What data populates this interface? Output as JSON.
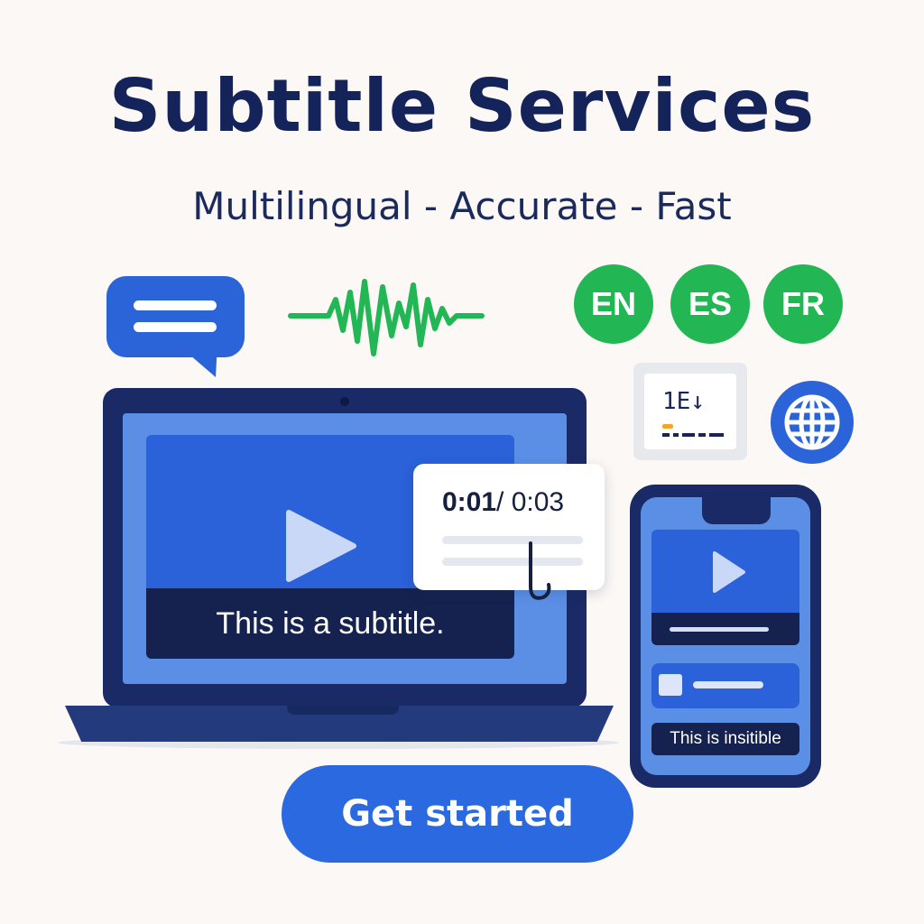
{
  "header": {
    "title": "Subtitle Services",
    "tagline": "Multilingual - Accurate - Fast"
  },
  "languages": [
    "EN",
    "ES",
    "FR"
  ],
  "editor_icon": {
    "text": "1E↓"
  },
  "laptop": {
    "subtitle": "This is a subtitle."
  },
  "timecode": {
    "current": "0:01",
    "total": "/ 0:03"
  },
  "phone": {
    "subtitle": "This is insitible"
  },
  "cta": {
    "label": "Get started"
  },
  "colors": {
    "background": "#fbf8f5",
    "title": "#14235a",
    "primary_blue": "#2b63d9",
    "navy": "#1a2a66",
    "green": "#22b754",
    "screen_blue": "#5b8fe6"
  },
  "icons": [
    "chat-bubble-icon",
    "audio-waveform-icon",
    "subtitle-editor-icon",
    "globe-icon",
    "play-icon"
  ]
}
